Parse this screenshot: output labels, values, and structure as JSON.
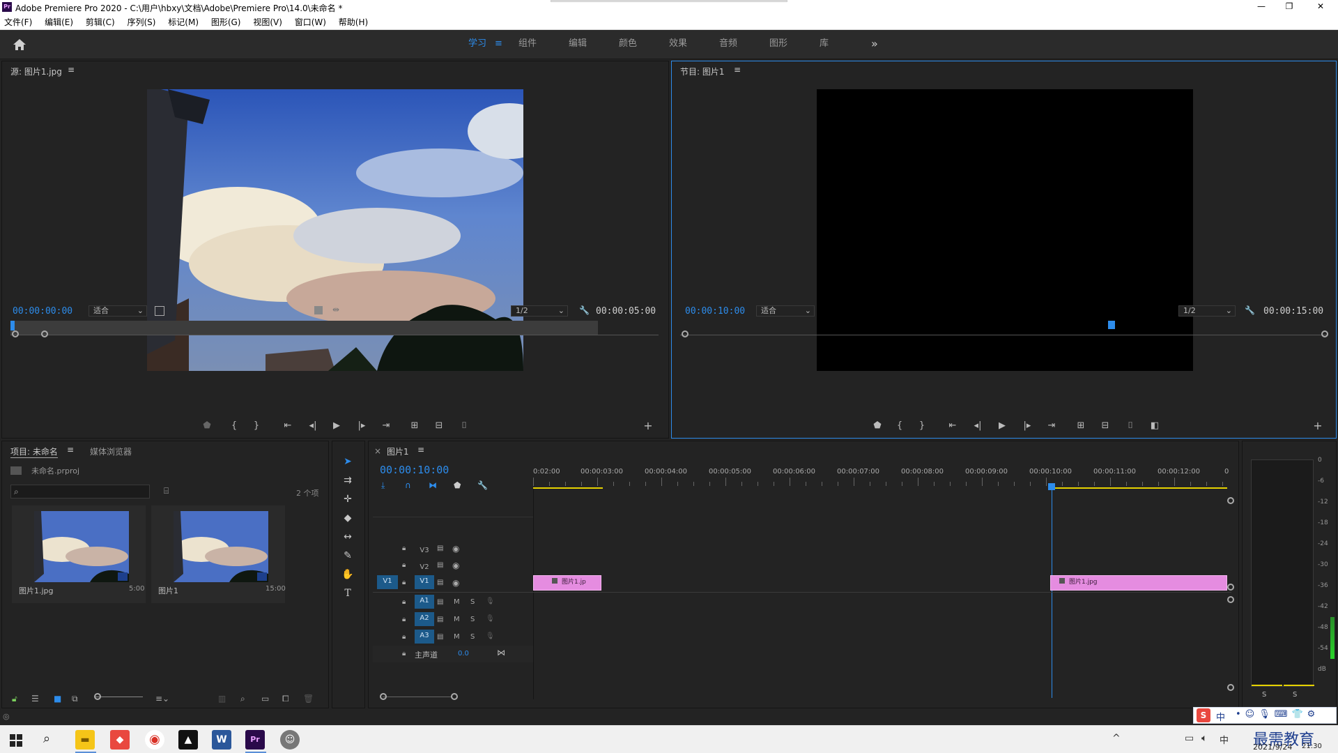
{
  "window": {
    "app_icon": "Pr",
    "title": "Adobe Premiere Pro 2020 - C:\\用户\\hbxy\\文档\\Adobe\\Premiere Pro\\14.0\\未命名 *",
    "minimize": "—",
    "restore": "❐",
    "close": "✕"
  },
  "menu": [
    "文件(F)",
    "编辑(E)",
    "剪辑(C)",
    "序列(S)",
    "标记(M)",
    "图形(G)",
    "视图(V)",
    "窗口(W)",
    "帮助(H)"
  ],
  "workspaces": {
    "tabs": [
      "学习",
      "组件",
      "编辑",
      "颜色",
      "效果",
      "音频",
      "图形",
      "库"
    ],
    "active": "学习",
    "menu_glyph": "≡",
    "overflow": "»"
  },
  "source_monitor": {
    "title": "源: 图片1.jpg",
    "menu_glyph": "≡",
    "timecode": "00:00:00:00",
    "fit": "适合",
    "resolution": "1/2",
    "duration": "00:00:05:00"
  },
  "program_monitor": {
    "title": "节目: 图片1",
    "menu_glyph": "≡",
    "timecode": "00:00:10:00",
    "fit": "适合",
    "resolution": "1/2",
    "duration": "00:00:15:00",
    "playhead_fraction": 0.667
  },
  "project": {
    "tab_project": "项目: 未命名",
    "tab_media": "媒体浏览器",
    "menu_glyph": "≡",
    "file": "未命名.prproj",
    "count": "2 个项",
    "items": [
      {
        "name": "图片1.jpg",
        "duration": "5:00"
      },
      {
        "name": "图片1",
        "duration": "15:00"
      }
    ]
  },
  "timeline": {
    "tab": "图片1",
    "close": "×",
    "menu_glyph": "≡",
    "timecode": "00:00:10:00",
    "ruler": [
      "0:02:00",
      "00:00:03:00",
      "00:00:04:00",
      "00:00:05:00",
      "00:00:06:00",
      "00:00:07:00",
      "00:00:08:00",
      "00:00:09:00",
      "00:00:10:00",
      "00:00:11:00",
      "00:00:12:00",
      "0"
    ],
    "video_tracks": [
      "V3",
      "V2",
      "V1"
    ],
    "audio_tracks": [
      "A1",
      "A2",
      "A3"
    ],
    "source_patch": "V1",
    "master": "主声道",
    "master_value": "0.0",
    "mute": "M",
    "solo": "S",
    "clips": [
      {
        "label": "图片1.jp"
      },
      {
        "label": "图片1.jpg"
      }
    ]
  },
  "audio_meter": {
    "scale": [
      "0",
      "-6",
      "-12",
      "-18",
      "-24",
      "-30",
      "-36",
      "-42",
      "-48",
      "-54",
      "dB"
    ],
    "solo_left": "S",
    "solo_right": "S"
  },
  "taskbar": {
    "time": "21:30",
    "date": "2021/9/24",
    "ime": "中",
    "watermark": "最需教育"
  },
  "colors": {
    "accent_blue": "#2d8ceb",
    "clip_pink": "#e58ce0",
    "panel_bg": "#232323",
    "work_area_yellow": "#e6d200"
  }
}
